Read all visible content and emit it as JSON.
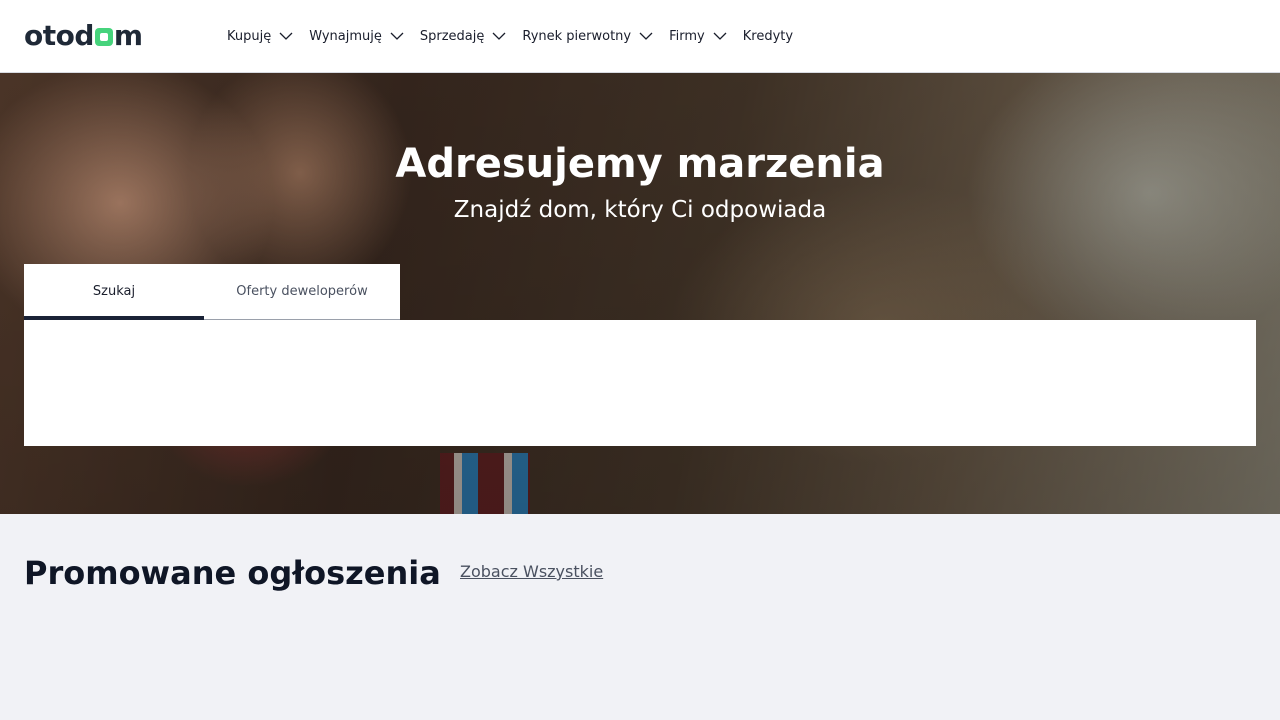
{
  "header": {
    "logo_text_left": "otod",
    "logo_text_right": "m",
    "nav": [
      {
        "label": "Kupuję",
        "icon": "chevron-down-icon"
      },
      {
        "label": "Wynajmuję",
        "icon": "chevron-down-icon"
      },
      {
        "label": "Sprzedaję",
        "icon": "chevron-down-icon"
      },
      {
        "label": "Rynek pierwotny",
        "icon": "chevron-down-icon"
      },
      {
        "label": "Firmy",
        "icon": "chevron-down-icon"
      },
      {
        "label": "Kredyty"
      }
    ]
  },
  "hero": {
    "title": "Adresujemy marzenia",
    "subtitle": "Znajdź dom, który Ci odpowiada"
  },
  "search": {
    "tabs": [
      {
        "label": "Szukaj",
        "active": true
      },
      {
        "label": "Oferty deweloperów",
        "active": false
      }
    ]
  },
  "promoted": {
    "title": "Promowane ogłoszenia",
    "see_all": "Zobacz Wszystkie"
  },
  "colors": {
    "brand_green": "#46d37c",
    "dark_navy": "#1a2236",
    "page_bg": "#f1f2f6"
  }
}
